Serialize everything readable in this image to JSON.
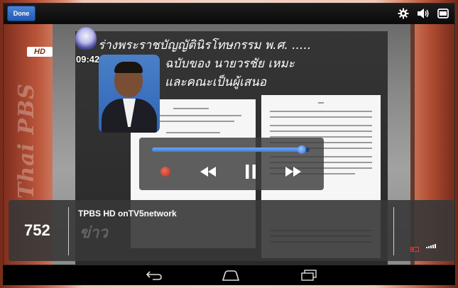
{
  "topbar": {
    "done_label": "Done",
    "icons": [
      "gear-icon",
      "volume-icon",
      "fullscreen-toggle-icon"
    ]
  },
  "tv": {
    "hd_logo": "HD",
    "channel_brand_vertical": "Thai PBS",
    "clock": "09:42",
    "title_lines": [
      "ร่างพระราชบัญญัตินิรโทษกรรม พ.ศ. .....",
      "ฉบับของ นายวรชัย เหมะ",
      "และคณะเป็นผู้เสนอ"
    ]
  },
  "player": {
    "progress_fraction": 0.95,
    "buttons": [
      "record-icon",
      "rewind-icon",
      "pause-icon",
      "fast-forward-icon"
    ]
  },
  "channel_info": {
    "number": "752",
    "name": "TPBS HD onTV5network",
    "watermark": "ข่าว"
  },
  "navbar": {
    "buttons": [
      "back-icon",
      "home-icon",
      "recent-apps-icon"
    ]
  },
  "colors": {
    "accent": "#2459b1",
    "seek_fill": "#3f7fd8",
    "record": "#b2301e",
    "battery_low": "#ee3333"
  }
}
